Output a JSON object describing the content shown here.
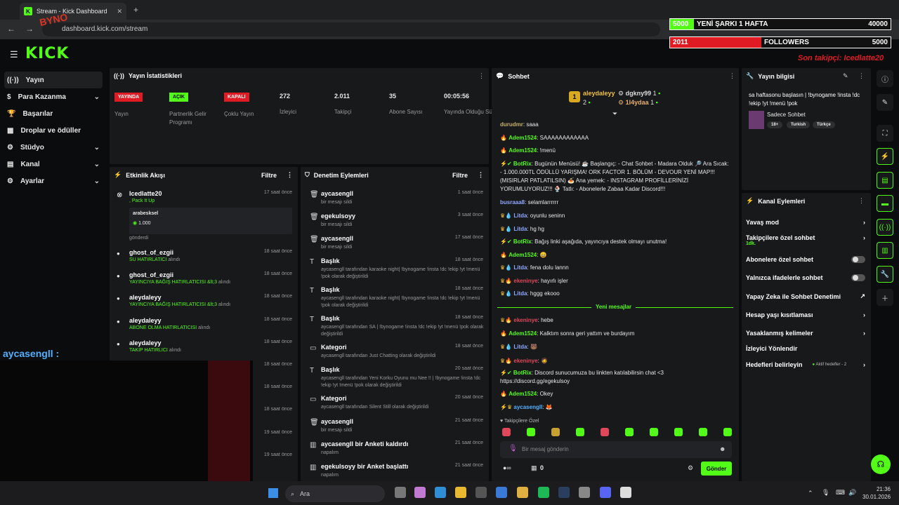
{
  "browser": {
    "tab_title": "Stream - Kick Dashboard",
    "url": "dashboard.kick.com/stream"
  },
  "overlay": {
    "bar1_left": "5000",
    "bar1_mid": "YENİ ŞARKI 1 HAFTA",
    "bar1_right": "40000",
    "bar2_left": "2011",
    "bar2_mid": "FOLLOWERS",
    "bar2_right": "5000",
    "last_follow": "Son takipçi: Icedlatte20",
    "brand": "BYNO",
    "cam_user": "aycasengll :"
  },
  "logo": "KICK",
  "sidebar": {
    "items": [
      {
        "label": "Yayın"
      },
      {
        "label": "Para Kazanma"
      },
      {
        "label": "Başarılar"
      },
      {
        "label": "Droplar ve ödüller"
      },
      {
        "label": "Stüdyo"
      },
      {
        "label": "Kanal"
      },
      {
        "label": "Ayarlar"
      }
    ]
  },
  "stats": {
    "title": "Yayın İstatistikleri",
    "cells": [
      {
        "badge": "YAYINDA",
        "label": "Yayın"
      },
      {
        "badge": "AÇIK",
        "label": "Partnerlik Gelir Programı"
      },
      {
        "badge": "KAPALI",
        "label": "Çoklu Yayın"
      },
      {
        "value": "272",
        "label": "İzleyici"
      },
      {
        "value": "2.011",
        "label": "Takipçi"
      },
      {
        "value": "35",
        "label": "Abone Sayısı"
      },
      {
        "value": "00:05:56",
        "label": "Yayında Olduğu Süre"
      }
    ]
  },
  "activity": {
    "title": "Etkinlik Akışı",
    "filter": "Filtre",
    "items": [
      {
        "user": "Icedlatte20",
        "sub": ", Pack It Up",
        "time": "17 saat önce",
        "gift_user": "arabesksel",
        "gift_amount": "1.000",
        "gift_sent": "gönderdi"
      },
      {
        "user": "ghost_of_ezgii",
        "sub": "SU HATIRLATICI",
        "suffix": "alındı",
        "time": "18 saat önce"
      },
      {
        "user": "ghost_of_ezgii",
        "sub": "YAYINCIYA BAĞIŞ HATIRLATICISI &lt;3",
        "suffix": "alındı",
        "time": "18 saat önce"
      },
      {
        "user": "aleydaleyy",
        "sub": "YAYINCIYA BAĞIŞ HATIRLATICISI &lt;3",
        "suffix": "alındı",
        "time": "18 saat önce"
      },
      {
        "user": "aleydaleyy",
        "sub": "ABONE OLMA HATIRLATICISI",
        "suffix": "alındı",
        "time": "18 saat önce"
      },
      {
        "user": "aleydaleyy",
        "sub": "TAKİP HATIRLICI",
        "suffix": "alındı",
        "time": "18 saat önce"
      },
      {
        "time": "18 saat önce"
      },
      {
        "time": "18 saat önce"
      },
      {
        "time": "18 saat önce"
      },
      {
        "time": "19 saat önce"
      },
      {
        "time": "19 saat önce"
      }
    ]
  },
  "mod": {
    "title": "Denetim Eylemleri",
    "filter": "Filtre",
    "items": [
      {
        "head": "aycasengll",
        "sub": "bir mesajı sildi",
        "time": "1 saat önce"
      },
      {
        "head": "egekulsoyy",
        "sub": "bir mesajı sildi",
        "time": "3 saat önce"
      },
      {
        "head": "aycasengll",
        "sub": "bir mesajı sildi",
        "time": "17 saat önce"
      },
      {
        "head": "Başlık",
        "sub": "aycasengll tarafından karaoke night| !bynogame !insta !dc !ekip !yt !menü !pok olarak değiştirildi",
        "time": "18 saat önce"
      },
      {
        "head": "Başlık",
        "sub": "aycasengll tarafından karaoke night| !bynogame !insta !dc !ekip !yt !menü !pok olarak değiştirildi",
        "time": "18 saat önce"
      },
      {
        "head": "Başlık",
        "sub": "aycasengll tarafından SA | !bynogame !insta !dc !ekip !yt !menü !pok olarak değiştirildi",
        "time": "18 saat önce"
      },
      {
        "head": "Kategori",
        "sub": "aycasengll tarafından Just Chatting olarak değiştirildi",
        "time": "18 saat önce"
      },
      {
        "head": "Başlık",
        "sub": "aycasengll tarafından Yeni Korku Oyunu mu Nee !! | !bynogame !insta !dc !ekip !yt !menü !pok olarak değiştirildi",
        "time": "20 saat önce"
      },
      {
        "head": "Kategori",
        "sub": "aycasengll tarafından Silent Still olarak değiştirildi",
        "time": "20 saat önce"
      },
      {
        "head": "aycasengll",
        "sub": "bir mesajı sildi",
        "time": "21 saat önce"
      },
      {
        "head": "aycasengll bir Anketi kaldırdı",
        "sub": "napalım",
        "time": "21 saat önce"
      },
      {
        "head": "egekulsoyy bir Anket başlattı",
        "sub": "napalım",
        "time": "21 saat önce"
      }
    ]
  },
  "chat": {
    "title": "Sohbet",
    "top1_user": "aleydaleyy",
    "top1_count": "2",
    "top2_user": "dgkny99",
    "top2_count": "1",
    "top3_user": "1l4ydaa",
    "top3_count": "1",
    "lines": [
      {
        "user": "durudmr",
        "text": ": saaa",
        "color": "#c8b06a"
      },
      {
        "user": "Adem1524",
        "text": ": SAAAAAAAAAAAA",
        "color": "#53fc18"
      },
      {
        "user": "Adem1524",
        "text": ": !menü",
        "color": "#53fc18"
      },
      {
        "user": "BotRix",
        "text": ": Bugünün Menüsü! ☕ Başlangıç: - Chat Sohbet - Madara Olduk 🔎 Ara Sıcak: - 1.000.000TL ÖDÜLLÜ YARIŞMA! ORK FACTOR 1. BÖLÜM - DEVOUR YENİ MAP!!! (MISIRLAR PATLATILSIN) 🍝 Ana yemek: - INSTAGRAM PROFİLLERİNİZİ YORUMLUYORUZ!!! 🍨 Tatlı: - Abonelerle Zabaa Kadar Discord!!!",
        "color": "#53fc18"
      },
      {
        "user": "busraaa8",
        "text": ": selamlarrrrrr",
        "color": "#8fa8ff"
      },
      {
        "user": "Litda",
        "text": ": oyunlu seninn",
        "color": "#8fa8ff"
      },
      {
        "user": "Litda",
        "text": ": hg hg",
        "color": "#8fa8ff"
      },
      {
        "user": "BotRix",
        "text": ": Bağış linki aşağıda, yayıncıya destek olmayı unutma!",
        "color": "#53fc18"
      },
      {
        "user": "Adem1524",
        "text": ":",
        "color": "#53fc18"
      },
      {
        "user": "Litda",
        "text": ": fena dolu lannn",
        "color": "#8fa8ff"
      },
      {
        "user": "ekeninye",
        "text": ": hayırlı işler",
        "color": "#e0475b"
      },
      {
        "user": "Litda",
        "text": ": hggg ekooo",
        "color": "#8fa8ff"
      },
      {
        "user": "ekeninye",
        "text": ": hebe",
        "color": "#e0475b"
      },
      {
        "user": "Adem1524",
        "text": ": Kalktım sonra geri yattım ve burdayım",
        "color": "#53fc18"
      },
      {
        "user": "Litda",
        "text": ":",
        "color": "#8fa8ff"
      },
      {
        "user": "ekeninye",
        "text": ":",
        "color": "#e0475b"
      },
      {
        "user": "BotRix",
        "text": ": Discord sunucumuza bu linkten katılabilirsin chat <3 https://discord.gg/egekulsoy",
        "color": "#53fc18"
      },
      {
        "user": "Adem1524",
        "text": ": Okey",
        "color": "#53fc18"
      },
      {
        "user": "aycasengll",
        "text": ":",
        "color": "#53b0ff"
      }
    ],
    "new_messages": "Yeni mesajlar",
    "followers_only": "Takipçilere Özel",
    "placeholder": "Bir mesaj gönderin",
    "points": "0",
    "send": "Gönder"
  },
  "info": {
    "title": "Yayın bilgisi",
    "stream_title": "sa haftasonu başlasın | !bynogame !insta !dc !ekip !yt !menü !pok",
    "category": "Sadece Sohbet",
    "tags": [
      "18+",
      "Turkish",
      "Türkçe"
    ]
  },
  "channel": {
    "title": "Kanal Eylemleri",
    "items": [
      {
        "label": "Yavaş mod"
      },
      {
        "label": "Takipçilere özel sohbet",
        "sub": "1dk."
      },
      {
        "label": "Abonelere özel sohbet"
      },
      {
        "label": "Yalnızca ifadelerle sohbet"
      },
      {
        "label": "Yapay Zeka ile Sohbet Denetimi"
      },
      {
        "label": "Hesap yaşı kısıtlaması"
      },
      {
        "label": "Yasaklanmış kelimeler"
      },
      {
        "label": "İzleyici Yönlendir"
      },
      {
        "label": "Hedefleri belirleyin",
        "extra": "Aktif hedefler - 2"
      }
    ]
  },
  "taskbar": {
    "search": "Ara",
    "time": "21:36",
    "date": "30.01.2026"
  }
}
